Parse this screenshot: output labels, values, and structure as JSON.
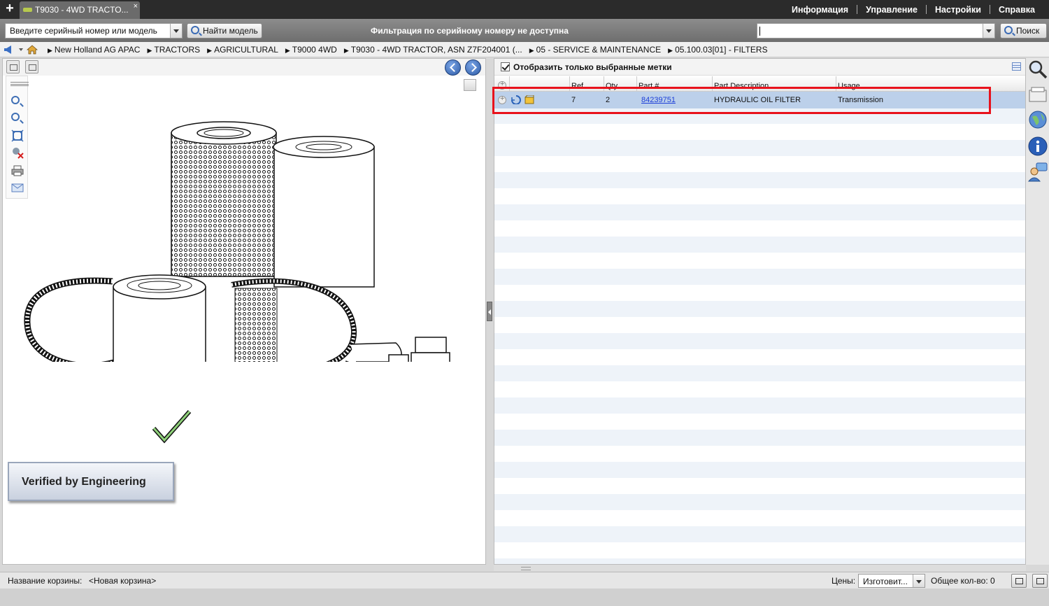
{
  "tab": {
    "title": "T9030 - 4WD TRACTO...",
    "close": "×"
  },
  "menu": [
    "Информация",
    "Управление",
    "Настройки",
    "Справка"
  ],
  "toolbar": {
    "serial_placeholder": "Введите серийный номер или модель",
    "find_label": "Найти модель",
    "filter_notice": "Фильтрация по серийному номеру не доступна",
    "search_value": "",
    "search_label": "Поиск"
  },
  "breadcrumbs": [
    "New Holland AG APAC",
    "TRACTORS",
    "AGRICULTURAL",
    "T9000 4WD",
    "T9030 - 4WD TRACTOR, ASN Z7F204001 (...",
    "05 - SERVICE & MAINTENANCE",
    "05.100.03[01] - FILTERS"
  ],
  "left": {
    "badge": "Verified by Engineering"
  },
  "right": {
    "only_selected_label": "Отобразить только выбранные метки",
    "only_selected_checked": true,
    "columns": {
      "ref": "Ref",
      "qty": "Qty",
      "part": "Part #",
      "desc": "Part Description",
      "usage": "Usage"
    },
    "rows": [
      {
        "ref": "7",
        "qty": "2",
        "part": "84239751",
        "desc": "HYDRAULIC OIL FILTER",
        "usage": "Transmission",
        "selected": true
      }
    ]
  },
  "status": {
    "cart_label": "Название корзины:",
    "cart_name": "<Новая корзина>",
    "prices_label": "Цены:",
    "prices_value": "Изготовит...",
    "qty_label": "Общее кол-во: 0"
  },
  "colors": {
    "accent": "#3a6fc4",
    "highlight": "#e8121c",
    "selected_row": "#bcd0ea",
    "link": "#1d3fd8"
  }
}
